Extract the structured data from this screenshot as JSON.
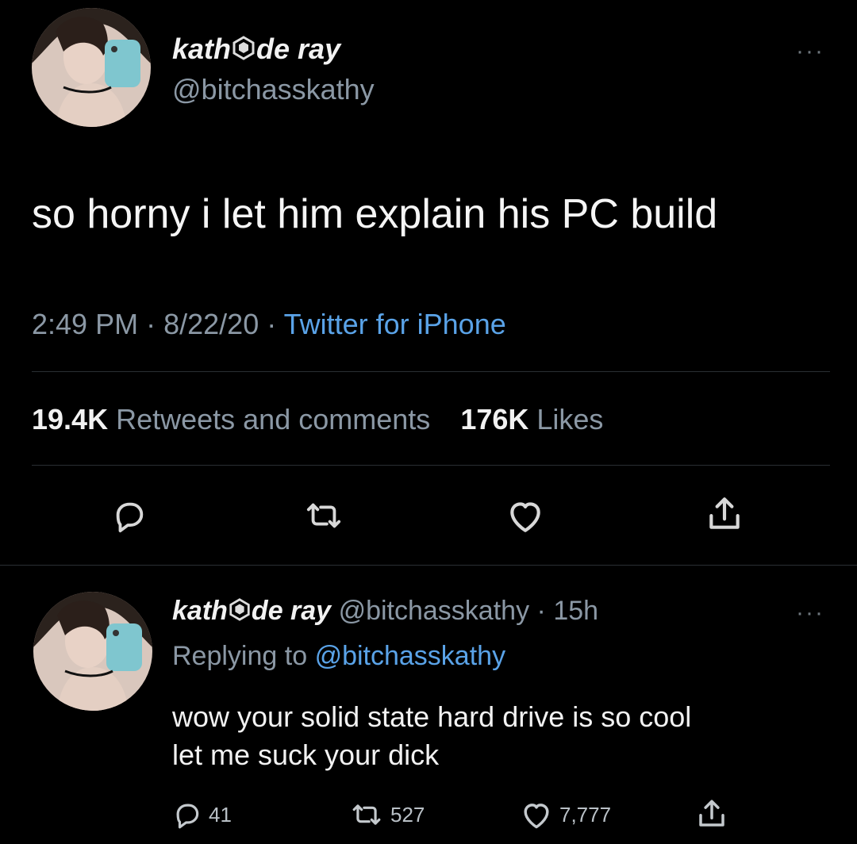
{
  "tweet": {
    "author_name_prefix": "kath",
    "author_name_suffix": "de ray",
    "name_emoji": "hexagon-badge-icon",
    "handle": "@bitchasskathy",
    "text": "so horny i let him explain his PC build",
    "meta_time": "2:49 PM",
    "meta_sep1": "·",
    "meta_date": "8/22/20",
    "meta_sep2": "·",
    "meta_source": "Twitter for iPhone",
    "retweets_count": "19.4K",
    "retweets_label": "Retweets and comments",
    "likes_count": "176K",
    "likes_label": "Likes",
    "more_label": "···"
  },
  "reply": {
    "author_name_prefix": "kath",
    "author_name_suffix": "de ray",
    "handle": "@bitchasskathy",
    "time_sep": "·",
    "time": "15h",
    "replying_prefix": "Replying to",
    "replying_handle": "@bitchasskathy",
    "text_line1": "wow your solid state hard drive is so cool",
    "text_line2": "let me suck your dick",
    "reply_count": "41",
    "retweet_count": "527",
    "like_count": "7,777",
    "more_label": "···"
  },
  "colors": {
    "background": "#000000",
    "text": "#e8e8e8",
    "muted": "#8b98a5",
    "link": "#5aa3e8",
    "divider": "#2a2f33"
  }
}
